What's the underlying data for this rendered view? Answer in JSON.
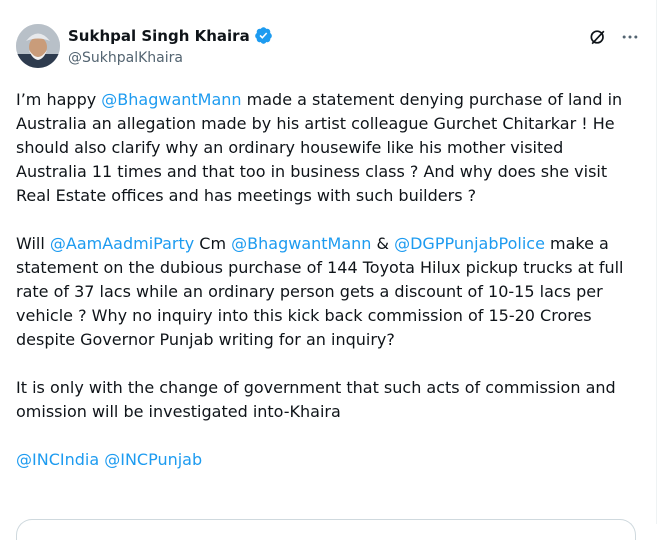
{
  "author": {
    "name": "Sukhpal Singh Khaira",
    "handle": "@SukhpalKhaira",
    "verified_icon": "verified-badge-icon",
    "avatar": "avatar"
  },
  "actions": {
    "grok_icon": "grok-icon",
    "more_icon": "more-icon"
  },
  "colors": {
    "link": "#1d9bf0",
    "text": "#0f1419",
    "muted": "#536471"
  },
  "tweet": {
    "p1": {
      "l1a": "I’m happy ",
      "l1m": "@BhagwantMann",
      "l1b": " made a statement denying purchase of land in",
      "l2": "Australia an allegation made by his artist colleague Gurchet Chitarkar ! He",
      "l3": "should also clarify why an ordinary housewife like his mother visited",
      "l4": "Australia 11 times and that too in business class ? And why does she visit",
      "l5": "Real Estate offices and has meetings with such builders ?"
    },
    "p2": {
      "l1a": "Will ",
      "l1m1": "@AamAadmiParty",
      "l1b": " Cm ",
      "l1m2": "@BhagwantMann",
      "l1c": " & ",
      "l1m3": "@DGPPunjabPolice",
      "l1d": " make a",
      "l2": "statement on the dubious purchase of 144 Toyota Hilux pickup trucks at full",
      "l3": "rate of 37 lacs while an ordinary person gets a discount of 10-15 lacs per",
      "l4": "vehicle ? Why no inquiry into this kick back commission of 15-20 Crores",
      "l5": "despite Governor Punjab writing for an inquiry?"
    },
    "p3": {
      "l1": "It is only with the change of government that such acts of commission and",
      "l2": "omission will be investigated into-Khaira"
    },
    "tags": {
      "t1": "@INCIndia",
      "sep": " ",
      "t2": "@INCPunjab"
    }
  }
}
